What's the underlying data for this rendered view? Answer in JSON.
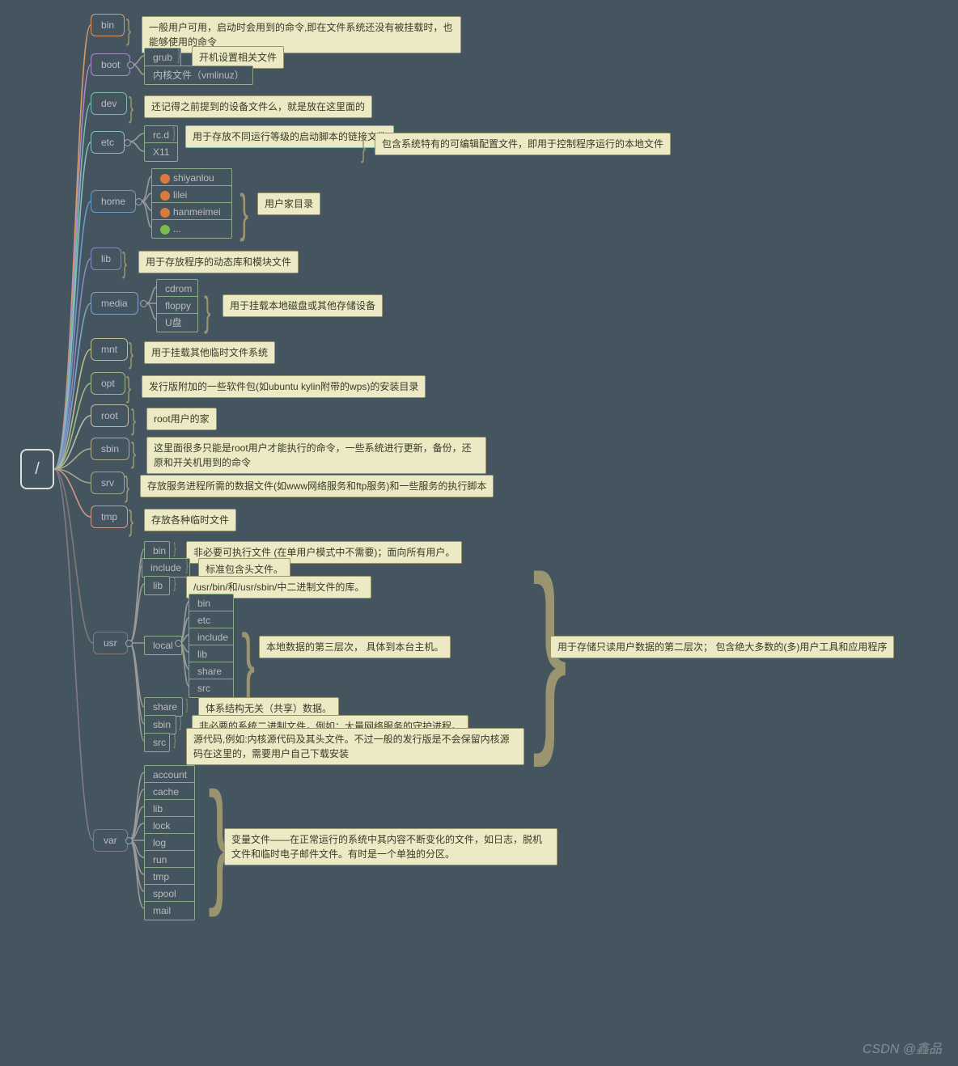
{
  "root": "/",
  "nodes": {
    "bin": "bin",
    "boot": "boot",
    "dev": "dev",
    "etc": "etc",
    "home": "home",
    "lib": "lib",
    "media": "media",
    "mnt": "mnt",
    "opt": "opt",
    "root": "root",
    "sbin": "sbin",
    "srv": "srv",
    "tmp": "tmp",
    "usr": "usr",
    "var": "var"
  },
  "bin_note": "一般用户可用，启动时会用到的命令,即在文件系统还没有被挂载时，也能够使用的命令",
  "boot": {
    "grub": "grub",
    "grub_note": "开机设置相关文件",
    "kernel": "内核文件（vmlinuz）"
  },
  "dev_note": "还记得之前提到的设备文件么，就是放在这里面的",
  "etc": {
    "rcd": "rc.d",
    "rcd_note": "用于存放不同运行等级的启动脚本的链接文件",
    "x11": "X11",
    "note": "包含系统特有的可编辑配置文件，即用于控制程序运行的本地文件"
  },
  "home": {
    "users": [
      "shiyanlou",
      "lilei",
      "hanmeimei",
      "..."
    ],
    "note": "用户家目录"
  },
  "lib_note": "用于存放程序的动态库和模块文件",
  "media": {
    "items": [
      "cdrom",
      "floppy",
      "U盘"
    ],
    "note": "用于挂载本地磁盘或其他存储设备"
  },
  "mnt_note": "用于挂载其他临时文件系统",
  "opt_note": "发行版附加的一些软件包(如ubuntu kylin附带的wps)的安装目录",
  "root_note": "root用户的家",
  "sbin_note": "这里面很多只能是root用户才能执行的命令，一些系统进行更新，备份，还原和开关机用到的命令",
  "srv_note": "存放服务进程所需的数据文件(如www网络服务和ftp服务)和一些服务的执行脚本",
  "tmp_note": "存放各种临时文件",
  "usr": {
    "bin": "bin",
    "bin_note": "非必要可执行文件 (在单用户模式中不需要)；面向所有用户。",
    "include": "include",
    "include_note": "标准包含头文件。",
    "lib": "lib",
    "lib_note": "/usr/bin/和/usr/sbin/中二进制文件的库。",
    "local": "local",
    "local_items": [
      "bin",
      "etc",
      "include",
      "lib",
      "share",
      "src"
    ],
    "local_note": "本地数据的第三层次， 具体到本台主机。",
    "share": "share",
    "share_note": "体系结构无关（共享）数据。",
    "sbin": "sbin",
    "sbin_note": "非必要的系统二进制文件，例如：大量网络服务的守护进程。",
    "src": "src",
    "src_note": "源代码,例如:内核源代码及其头文件。不过一般的发行版是不会保留内核源码在这里的，需要用户自己下载安装",
    "overall": "用于存储只读用户数据的第二层次； 包含绝大多数的(多)用户工具和应用程序"
  },
  "var": {
    "items": [
      "account",
      "cache",
      "lib",
      "lock",
      "log",
      "run",
      "tmp",
      "spool",
      "mail"
    ],
    "note": "变量文件——在正常运行的系统中其内容不断变化的文件，如日志，脱机文件和临时电子邮件文件。有时是一个单独的分区。"
  },
  "watermark": "CSDN @鑫品"
}
